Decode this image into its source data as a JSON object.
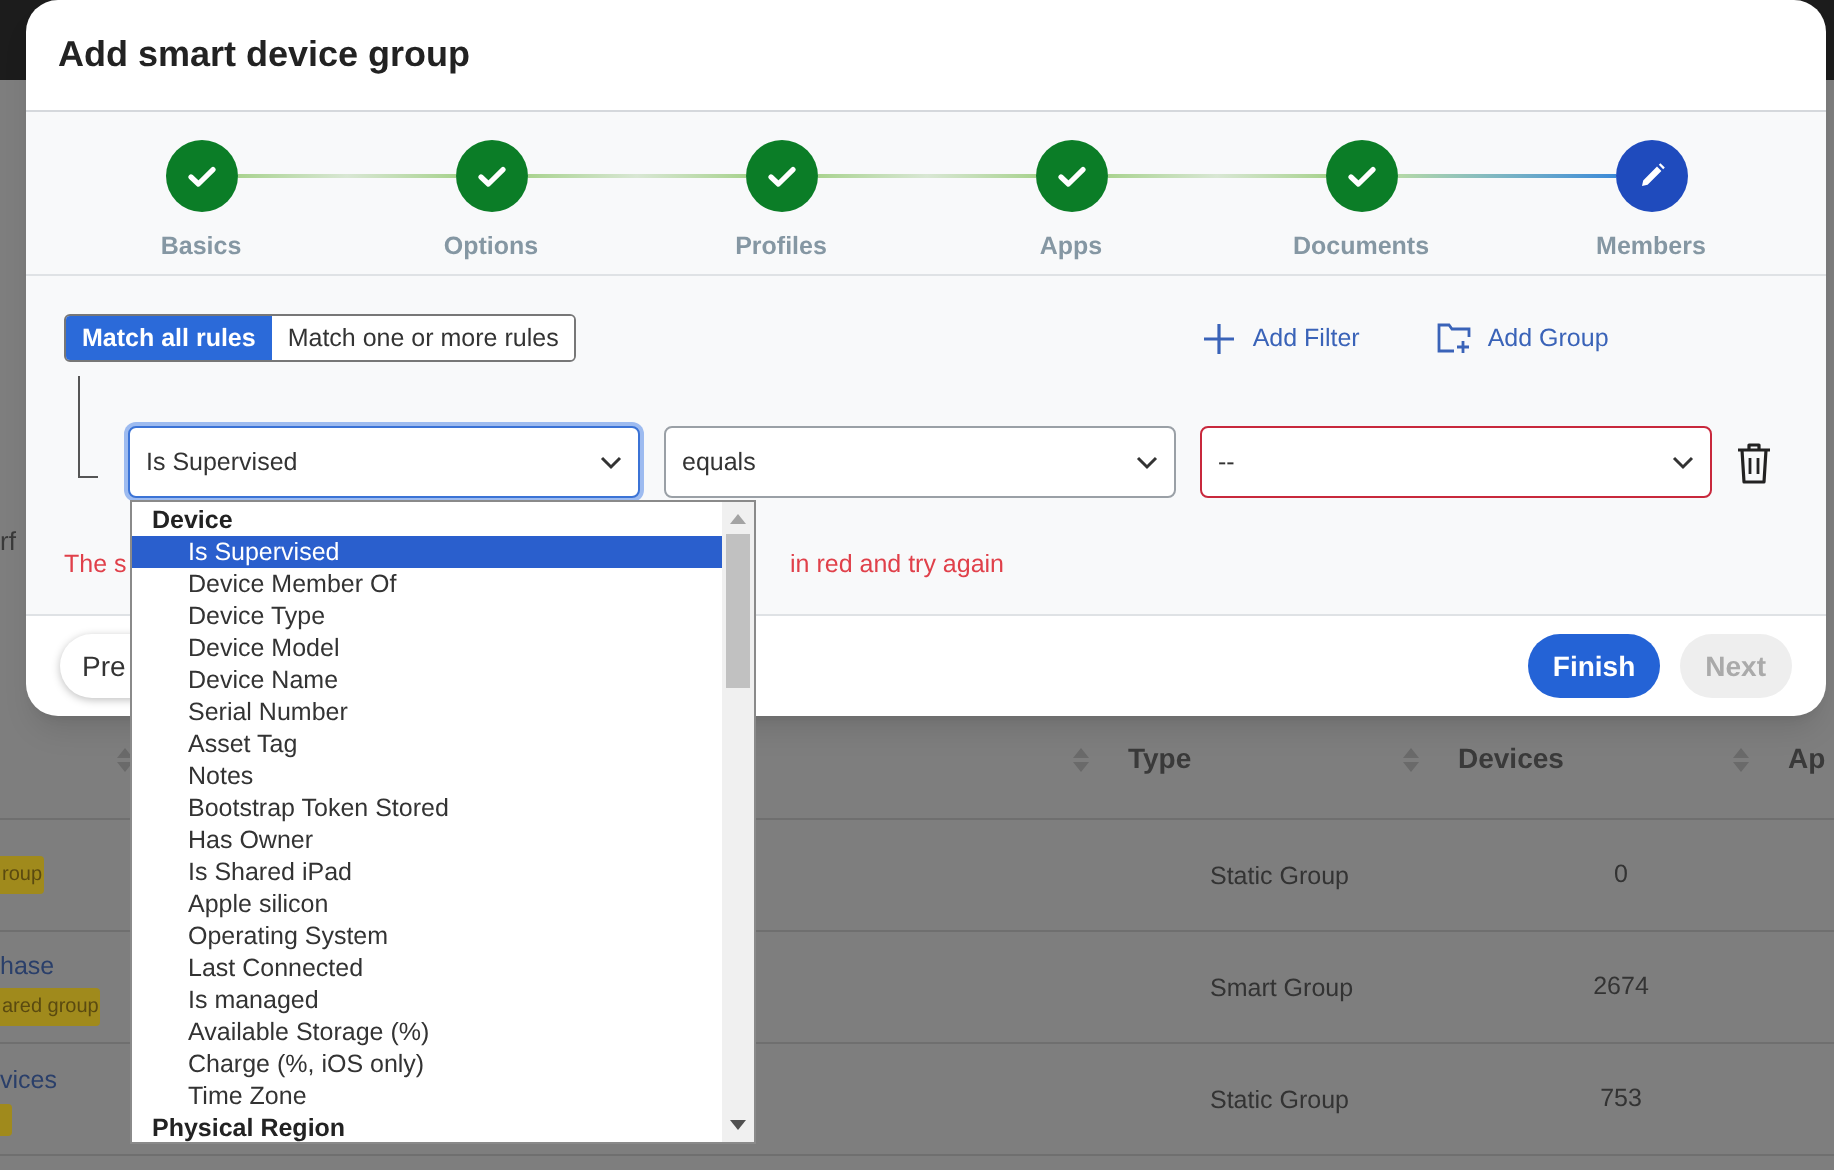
{
  "background": {
    "side_text": "rf",
    "columns": [
      {},
      {
        "label": "Type"
      },
      {
        "label": "Devices"
      },
      {
        "label": "Ap"
      }
    ],
    "rows": [
      {
        "badge": "roup",
        "type": "Static Group",
        "devices": "0"
      },
      {
        "name": "hase",
        "badge": "ared group",
        "type": "Smart Group",
        "devices": "2674"
      },
      {
        "name": "vices",
        "tag_stub": true,
        "type": "Static Group",
        "devices": "753"
      }
    ]
  },
  "dialog": {
    "title": "Add smart device group",
    "steps": [
      {
        "label": "Basics",
        "completed": true
      },
      {
        "label": "Options",
        "completed": true
      },
      {
        "label": "Profiles",
        "completed": true
      },
      {
        "label": "Apps",
        "completed": true
      },
      {
        "label": "Documents",
        "completed": true
      },
      {
        "label": "Members",
        "completed": false
      }
    ],
    "match_modes": [
      {
        "label": "Match all rules",
        "selected": true
      },
      {
        "label": "Match one or more rules",
        "selected": false
      }
    ],
    "actions": [
      {
        "kind": "filter",
        "label": "Add Filter"
      },
      {
        "kind": "group",
        "label": "Add Group"
      }
    ],
    "rule": {
      "field": {
        "value": "Is Supervised",
        "focused": true,
        "invalid": false
      },
      "operator": {
        "value": "equals",
        "focused": false,
        "invalid": false
      },
      "value": {
        "value": "--",
        "focused": false,
        "invalid": true
      }
    },
    "error_parts": [
      "The s",
      "in red and try again"
    ],
    "footer": {
      "previous": "Pre",
      "finish": {
        "label": "Finish",
        "disabled": false
      },
      "next": {
        "label": "Next",
        "disabled": true
      }
    }
  },
  "dropdown": {
    "groups": [
      {
        "label": "Device",
        "options": [
          {
            "label": "Is Supervised",
            "selected": true
          },
          {
            "label": "Device Member Of",
            "selected": false
          },
          {
            "label": "Device Type",
            "selected": false
          },
          {
            "label": "Device Model",
            "selected": false
          },
          {
            "label": "Device Name",
            "selected": false
          },
          {
            "label": "Serial Number",
            "selected": false
          },
          {
            "label": "Asset Tag",
            "selected": false
          },
          {
            "label": "Notes",
            "selected": false
          },
          {
            "label": "Bootstrap Token Stored",
            "selected": false
          },
          {
            "label": "Has Owner",
            "selected": false
          },
          {
            "label": "Is Shared iPad",
            "selected": false
          },
          {
            "label": "Apple silicon",
            "selected": false
          },
          {
            "label": "Operating System",
            "selected": false
          },
          {
            "label": "Last Connected",
            "selected": false
          },
          {
            "label": "Is managed",
            "selected": false
          },
          {
            "label": "Available Storage (%)",
            "selected": false
          },
          {
            "label": "Charge (%, iOS only)",
            "selected": false
          },
          {
            "label": "Time Zone",
            "selected": false
          }
        ]
      },
      {
        "label": "Physical Region"
      }
    ]
  }
}
